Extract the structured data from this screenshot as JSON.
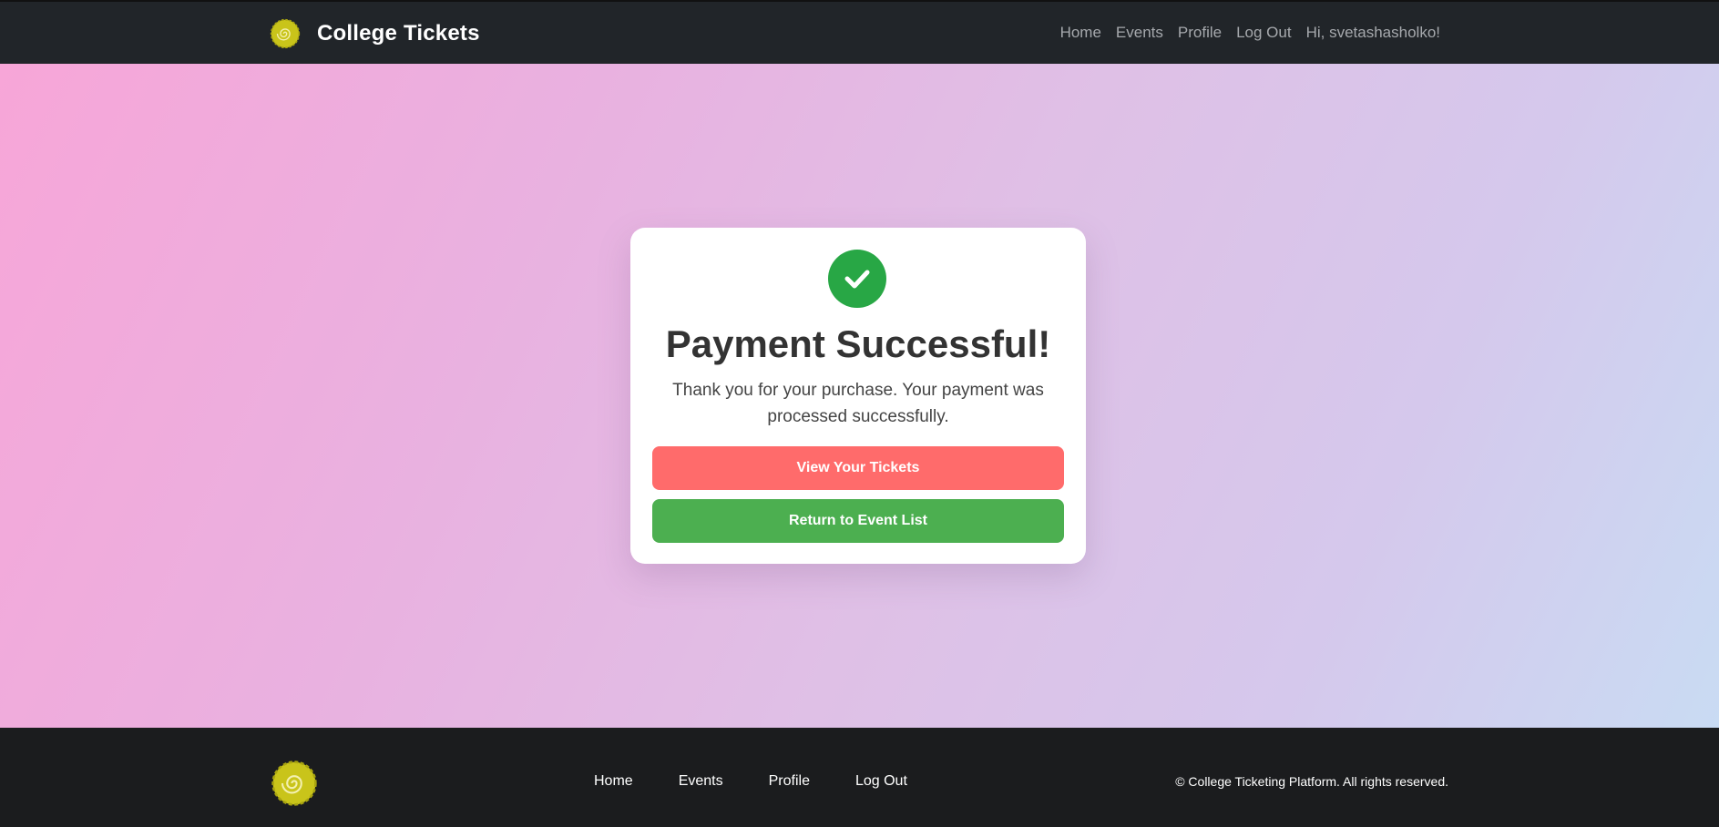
{
  "nav": {
    "brand": "College Tickets",
    "links": [
      "Home",
      "Events",
      "Profile",
      "Log Out"
    ],
    "greeting": "Hi, svetashasholko!"
  },
  "card": {
    "title": "Payment Successful!",
    "message": "Thank you for your purchase. Your payment was processed successfully.",
    "primary_button": "View Your Tickets",
    "secondary_button": "Return to Event List"
  },
  "footer": {
    "links": [
      "Home",
      "Events",
      "Profile",
      "Log Out"
    ],
    "copyright": "© College Ticketing Platform. All rights reserved."
  },
  "colors": {
    "navbar": "#212529",
    "success": "#28a745",
    "primary_button": "#ff6b6b",
    "secondary_button": "#4caf50",
    "logo": "#c9c41a"
  },
  "icons": {
    "brand_logo": "spiral-logo-icon",
    "success": "checkmark-icon"
  }
}
